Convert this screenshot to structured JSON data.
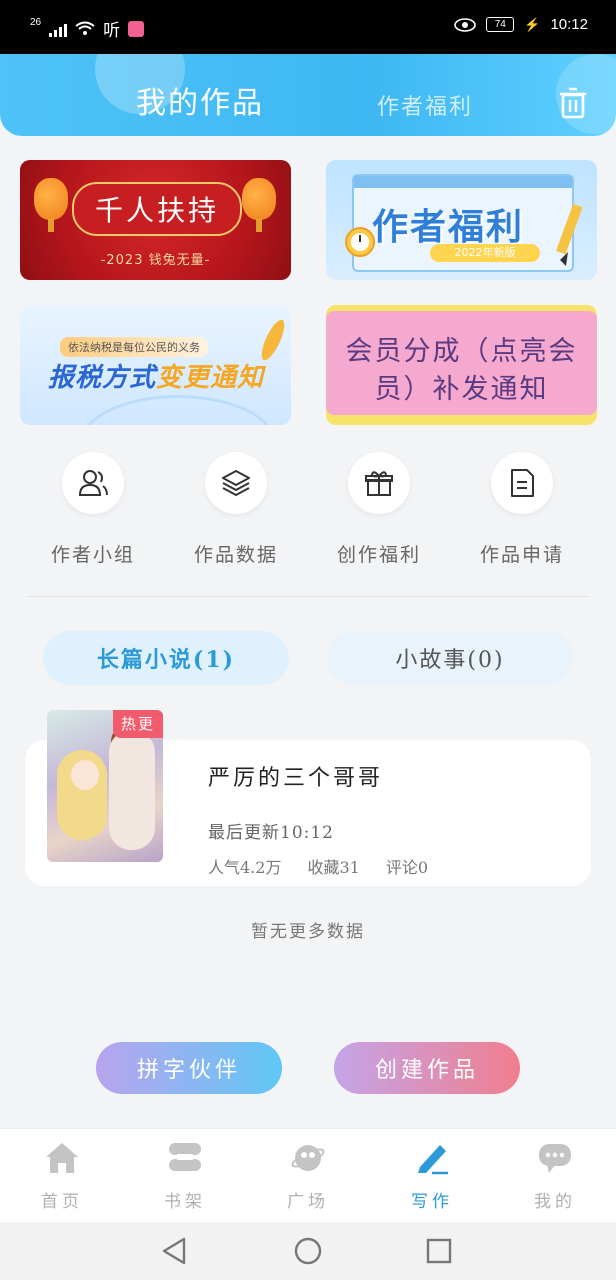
{
  "status_bar": {
    "network": "26",
    "carrier_icon_text": "听",
    "battery": "74",
    "time": "10:12"
  },
  "header": {
    "title": "我的作品",
    "tab2": "作者福利",
    "trash_icon": "trash-icon"
  },
  "banners": {
    "b1_title": "千人扶持",
    "b1_sub": "-2023 钱兔无量-",
    "b2_title": "作者福利",
    "b2_sub": "2022年新版",
    "b3_small": "依法纳税是每位公民的义务",
    "b3_big1": "报税方式",
    "b3_big2": "变更通知",
    "b4_title": "会员分成（点亮会员）补发通知"
  },
  "shortcuts": [
    {
      "label": "作者小组",
      "icon": "users-icon"
    },
    {
      "label": "作品数据",
      "icon": "layers-icon"
    },
    {
      "label": "创作福利",
      "icon": "gift-icon"
    },
    {
      "label": "作品申请",
      "icon": "document-icon"
    }
  ],
  "work_tabs": {
    "novel": "长篇小说(1)",
    "story": "小故事(0)"
  },
  "work": {
    "tag": "热更",
    "title": "严厉的三个哥哥",
    "update": "最后更新10:12",
    "popularity": "人气4.2万",
    "favorites": "收藏31",
    "comments": "评论0"
  },
  "no_more": "暂无更多数据",
  "actions": {
    "partner": "拼字伙伴",
    "create": "创建作品"
  },
  "tabbar": [
    {
      "label": "首页",
      "icon": "home-icon"
    },
    {
      "label": "书架",
      "icon": "bookshelf-icon"
    },
    {
      "label": "广场",
      "icon": "planet-icon"
    },
    {
      "label": "写作",
      "icon": "pen-icon"
    },
    {
      "label": "我的",
      "icon": "chat-icon"
    }
  ],
  "colors": {
    "accent": "#2d9ad8",
    "header_gradient_start": "#4fc3f7",
    "tag": "#f25b6b"
  }
}
